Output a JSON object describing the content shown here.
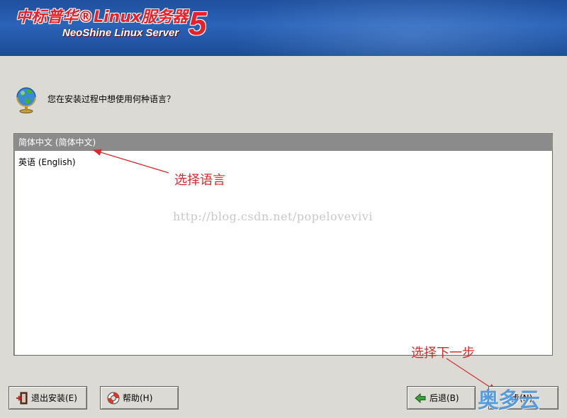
{
  "banner": {
    "logo_cn": "中标普华®Linux服务器",
    "logo_en": "NeoShine Linux Server",
    "logo_version": "5"
  },
  "prompt": {
    "icon": "globe-icon",
    "text": "您在安装过程中想使用何种语言？"
  },
  "languages": [
    {
      "label": "简体中文 (简体中文)",
      "selected": true
    },
    {
      "label": "英语 (English)",
      "selected": false
    }
  ],
  "watermark": "http://blog.csdn.net/popelovevivi",
  "annotations": {
    "select_language": "选择语言",
    "next_step": "选择下一步",
    "color": "#d42a2a"
  },
  "buttons": {
    "exit_label": "退出安装(E)",
    "help_label": "帮助(H)",
    "back_label": "后退(B)",
    "next_label": "步(N)"
  },
  "site_logo": "奥多云",
  "colors": {
    "banner": "#2a63b8",
    "background": "#dcdad5",
    "selection": "#8b8b8b"
  }
}
